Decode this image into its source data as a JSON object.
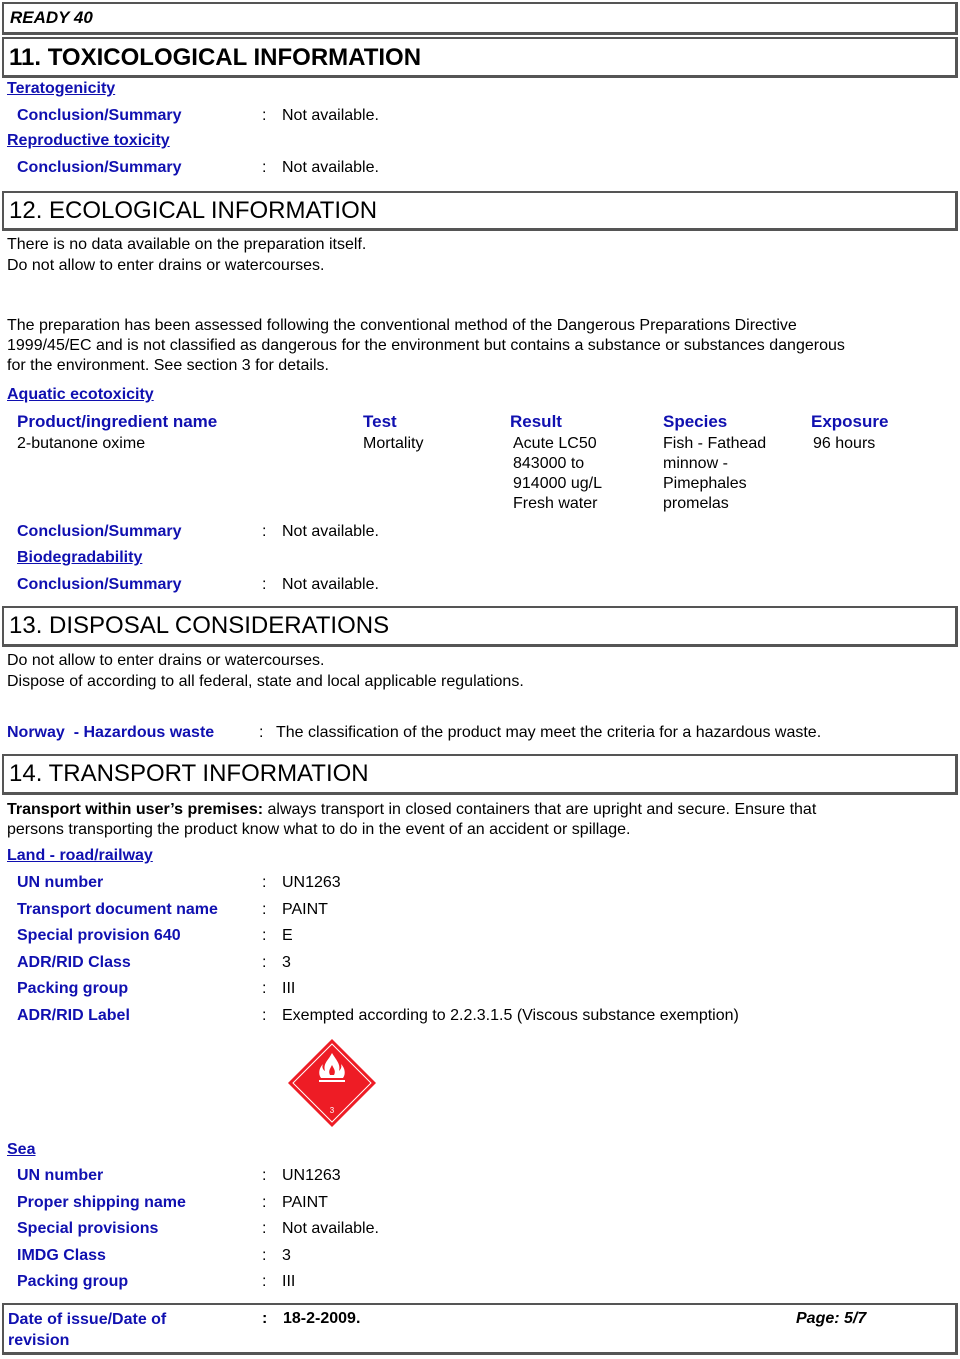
{
  "header": {
    "product": "READY 40"
  },
  "section11": {
    "title": "11. TOXICOLOGICAL INFORMATION",
    "teratogenicity": {
      "heading": "Teratogenicity",
      "label": "Conclusion/Summary",
      "value": "Not available."
    },
    "reproductive": {
      "heading": "Reproductive toxicity",
      "label": "Conclusion/Summary",
      "value": "Not available."
    }
  },
  "section12": {
    "title": "12. ECOLOGICAL INFORMATION",
    "intro_lines": [
      "There is no data available on the preparation itself.",
      "Do not allow to enter drains or watercourses."
    ],
    "assessment_lines": [
      "The preparation has been assessed following the conventional method of the Dangerous Preparations Directive",
      "1999/45/EC and is not classified as dangerous for the environment but contains a substance or substances dangerous",
      "for the environment. See section 3 for details."
    ],
    "aquatic": {
      "heading": "Aquatic ecotoxicity",
      "columns": [
        "Product/ingredient name",
        "Test",
        "Result",
        "Species",
        "Exposure"
      ],
      "rows": [
        {
          "name": "2-butanone oxime",
          "test": "Mortality",
          "result": [
            "Acute LC50",
            "843000 to",
            "914000 ug/L",
            "Fresh water"
          ],
          "species": [
            "Fish - Fathead",
            "minnow -",
            "Pimephales",
            "promelas"
          ],
          "exposure": "96 hours"
        }
      ],
      "conclusion_label": "Conclusion/Summary",
      "conclusion_value": "Not available."
    },
    "biodegradability": {
      "heading": "Biodegradability",
      "label": "Conclusion/Summary",
      "value": "Not available."
    }
  },
  "section13": {
    "title": "13. DISPOSAL CONSIDERATIONS",
    "lines": [
      "Do not allow to enter drains or watercourses.",
      "Dispose of according to all federal, state and local applicable regulations."
    ],
    "norway": {
      "label": "Norway  - Hazardous waste",
      "value": "The classification of the product may meet the criteria for a hazardous waste."
    }
  },
  "section14": {
    "title": "14. TRANSPORT INFORMATION",
    "premises_bold": "Transport within user’s premises:",
    "premises_text_1": " always transport in closed containers that are upright and secure. Ensure that",
    "premises_text_2": "persons transporting the product know what to do in the event of an accident or spillage.",
    "land": {
      "heading": "Land - road/railway",
      "fields": [
        {
          "label": "UN number",
          "value": "UN1263"
        },
        {
          "label": "Transport document name",
          "value": "PAINT"
        },
        {
          "label": "Special provision 640",
          "value": "E"
        },
        {
          "label": "ADR/RID Class",
          "value": "3"
        },
        {
          "label": "Packing group",
          "value": "III"
        },
        {
          "label": "ADR/RID Label",
          "value": "Exempted according to 2.2.3.1.5 (Viscous substance exemption)"
        }
      ],
      "label_icon": "flammable-liquid-class-3-icon",
      "label_icon_number": "3",
      "label_color": "#ee1c25"
    },
    "sea": {
      "heading": "Sea",
      "fields": [
        {
          "label": "UN number",
          "value": "UN1263"
        },
        {
          "label": "Proper shipping name",
          "value": "PAINT"
        },
        {
          "label": "Special provisions",
          "value": "Not available."
        },
        {
          "label": "IMDG Class",
          "value": "3"
        },
        {
          "label": "Packing group",
          "value": "III"
        }
      ]
    }
  },
  "footer": {
    "label_line1": "Date of issue/Date of",
    "label_line2": "revision",
    "date": "18-2-2009.",
    "page": "Page: 5/7"
  },
  "colors": {
    "label_blue": "#1010b0",
    "border": "#555555",
    "hazard_red": "#ee1c25"
  }
}
